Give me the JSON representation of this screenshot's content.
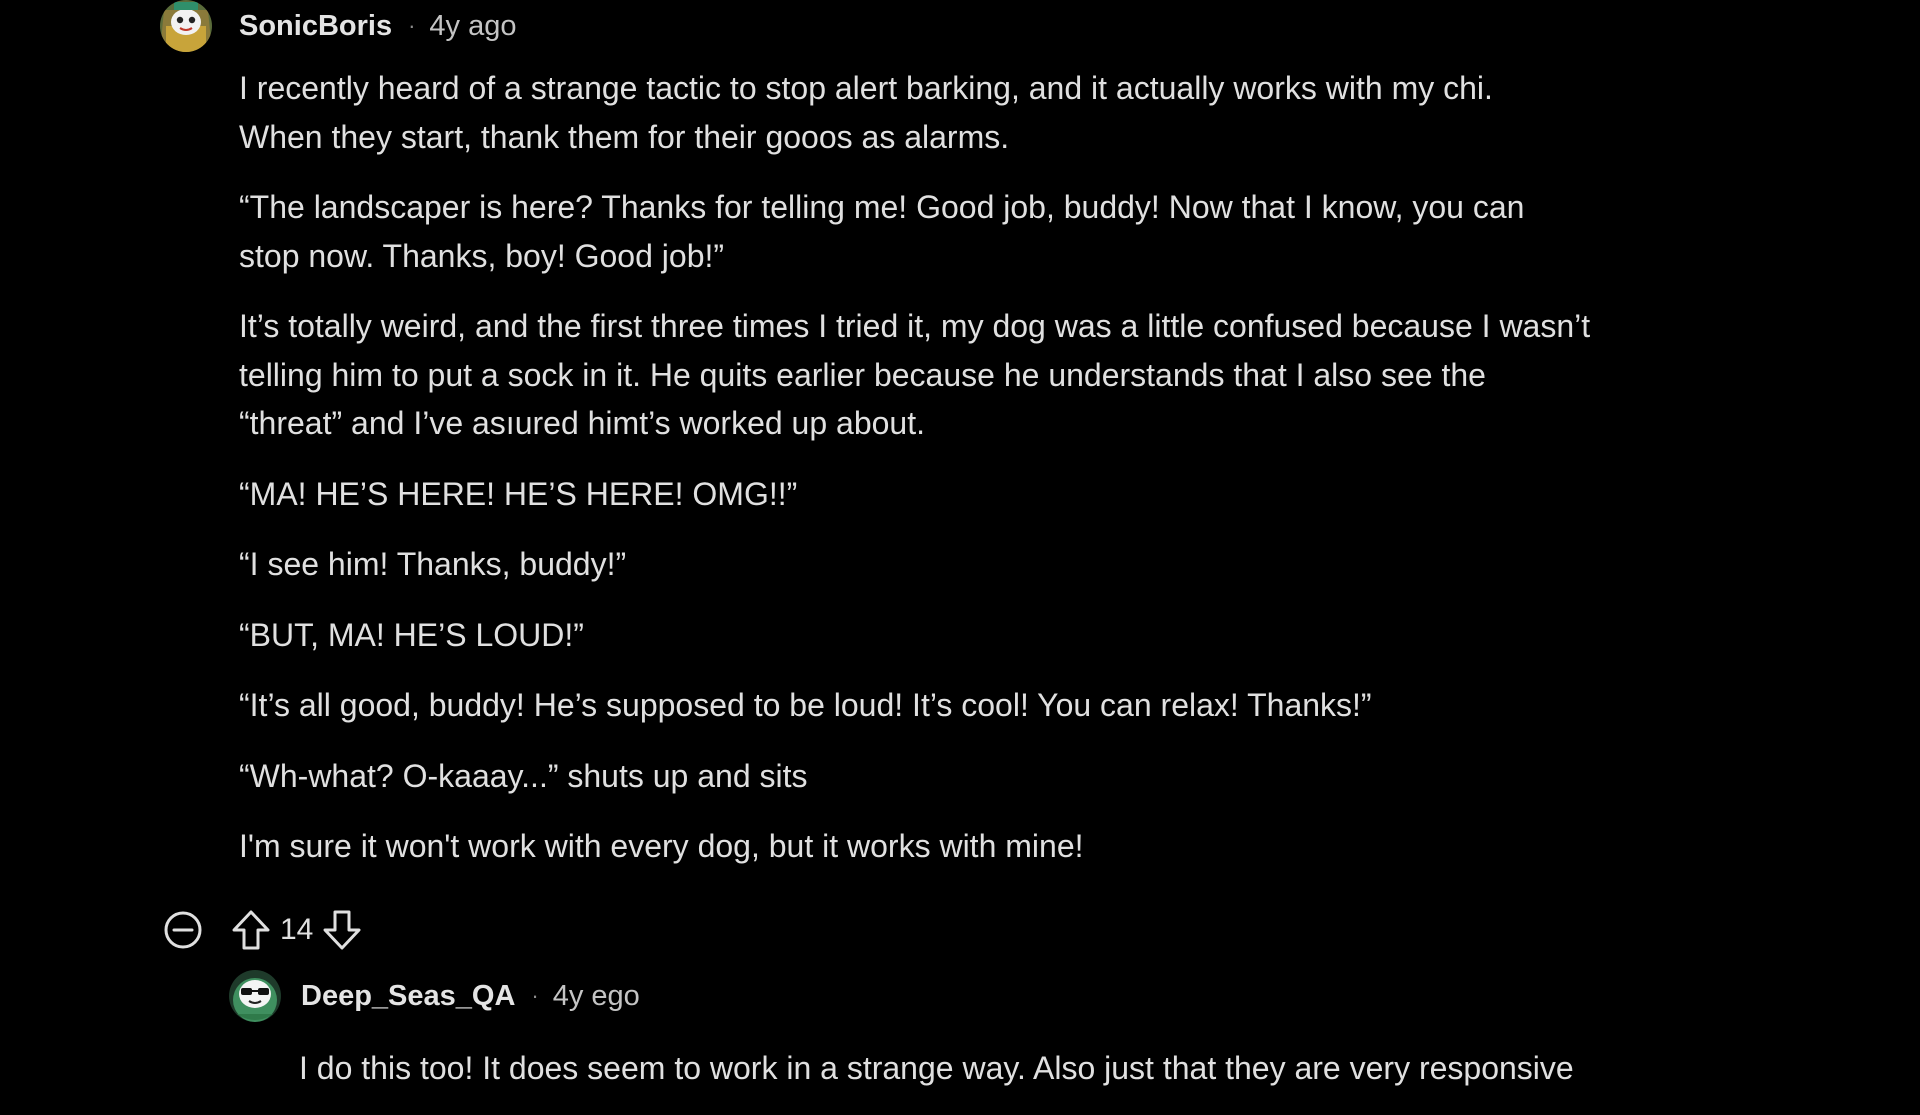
{
  "comment": {
    "username": "SonicBoris",
    "separator": "·",
    "time": "4y ago",
    "avatar_icon": "snoo-avatar-icon",
    "paragraphs": [
      "I recently heard of a strange tactic to stop alert barking, and it actually works with my chi.\nWhen they start, thank them for their gooos as alarms.",
      "“The landscaper is here? Thanks for telling me! Good job, buddy! Now that I know, you can\nstop now. Thanks, boy! Good job!”",
      "It’s totally weird, and the first three times I tried it, my dog was a little confused because I wasn’t\ntelling him to put a sock in it. He quits earlier because he understands that I also see the\n“threat” and I’ve asıured himt’s worked up about.",
      "“MA! HE’S HERE! HE’S HERE!  OMG!!”",
      "“I see him! Thanks, buddy!”",
      "“BUT, MA! HE’S LOUD!”",
      "“It’s all good, buddy! He’s supposed to be loud! It’s cool! You can relax! Thanks!”",
      "“Wh-what? O-kaaay...” shuts up and sits",
      "I'm sure it won't work with every dog, but it works with mine!"
    ],
    "score": "14",
    "icons": {
      "collapse": "collapse-minus-circle-icon",
      "upvote": "upvote-arrow-icon",
      "downvote": "downvote-arrow-icon"
    }
  },
  "reply": {
    "username": "Deep_Seas_QA",
    "separator": "·",
    "time": "4y ego",
    "avatar_icon": "snoo-avatar-icon",
    "text": "I do this too! It does seem to work in a strange way. Also just that they are very responsive"
  },
  "colors": {
    "background": "#000000",
    "text": "#e0e0e0",
    "muted": "#8d8d8d"
  }
}
